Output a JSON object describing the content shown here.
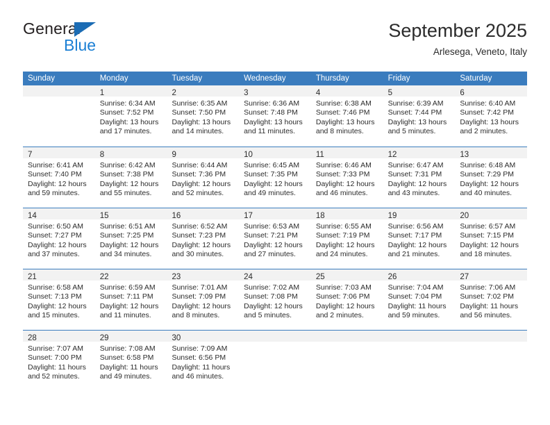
{
  "brand": {
    "name_part1": "General",
    "name_part2": "Blue",
    "accent_color": "#1b7fd4",
    "triangle_color": "#1b6cb4"
  },
  "header": {
    "title": "September 2025",
    "subtitle": "Arlesega, Veneto, Italy"
  },
  "calendar": {
    "header_bg": "#3a7cbe",
    "date_strip_bg": "#f2f2f2",
    "weekdays": [
      "Sunday",
      "Monday",
      "Tuesday",
      "Wednesday",
      "Thursday",
      "Friday",
      "Saturday"
    ],
    "weeks": [
      [
        {
          "date": "",
          "sunrise": "",
          "sunset": "",
          "daylight1": "",
          "daylight2": ""
        },
        {
          "date": "1",
          "sunrise": "Sunrise: 6:34 AM",
          "sunset": "Sunset: 7:52 PM",
          "daylight1": "Daylight: 13 hours",
          "daylight2": "and 17 minutes."
        },
        {
          "date": "2",
          "sunrise": "Sunrise: 6:35 AM",
          "sunset": "Sunset: 7:50 PM",
          "daylight1": "Daylight: 13 hours",
          "daylight2": "and 14 minutes."
        },
        {
          "date": "3",
          "sunrise": "Sunrise: 6:36 AM",
          "sunset": "Sunset: 7:48 PM",
          "daylight1": "Daylight: 13 hours",
          "daylight2": "and 11 minutes."
        },
        {
          "date": "4",
          "sunrise": "Sunrise: 6:38 AM",
          "sunset": "Sunset: 7:46 PM",
          "daylight1": "Daylight: 13 hours",
          "daylight2": "and 8 minutes."
        },
        {
          "date": "5",
          "sunrise": "Sunrise: 6:39 AM",
          "sunset": "Sunset: 7:44 PM",
          "daylight1": "Daylight: 13 hours",
          "daylight2": "and 5 minutes."
        },
        {
          "date": "6",
          "sunrise": "Sunrise: 6:40 AM",
          "sunset": "Sunset: 7:42 PM",
          "daylight1": "Daylight: 13 hours",
          "daylight2": "and 2 minutes."
        }
      ],
      [
        {
          "date": "7",
          "sunrise": "Sunrise: 6:41 AM",
          "sunset": "Sunset: 7:40 PM",
          "daylight1": "Daylight: 12 hours",
          "daylight2": "and 59 minutes."
        },
        {
          "date": "8",
          "sunrise": "Sunrise: 6:42 AM",
          "sunset": "Sunset: 7:38 PM",
          "daylight1": "Daylight: 12 hours",
          "daylight2": "and 55 minutes."
        },
        {
          "date": "9",
          "sunrise": "Sunrise: 6:44 AM",
          "sunset": "Sunset: 7:36 PM",
          "daylight1": "Daylight: 12 hours",
          "daylight2": "and 52 minutes."
        },
        {
          "date": "10",
          "sunrise": "Sunrise: 6:45 AM",
          "sunset": "Sunset: 7:35 PM",
          "daylight1": "Daylight: 12 hours",
          "daylight2": "and 49 minutes."
        },
        {
          "date": "11",
          "sunrise": "Sunrise: 6:46 AM",
          "sunset": "Sunset: 7:33 PM",
          "daylight1": "Daylight: 12 hours",
          "daylight2": "and 46 minutes."
        },
        {
          "date": "12",
          "sunrise": "Sunrise: 6:47 AM",
          "sunset": "Sunset: 7:31 PM",
          "daylight1": "Daylight: 12 hours",
          "daylight2": "and 43 minutes."
        },
        {
          "date": "13",
          "sunrise": "Sunrise: 6:48 AM",
          "sunset": "Sunset: 7:29 PM",
          "daylight1": "Daylight: 12 hours",
          "daylight2": "and 40 minutes."
        }
      ],
      [
        {
          "date": "14",
          "sunrise": "Sunrise: 6:50 AM",
          "sunset": "Sunset: 7:27 PM",
          "daylight1": "Daylight: 12 hours",
          "daylight2": "and 37 minutes."
        },
        {
          "date": "15",
          "sunrise": "Sunrise: 6:51 AM",
          "sunset": "Sunset: 7:25 PM",
          "daylight1": "Daylight: 12 hours",
          "daylight2": "and 34 minutes."
        },
        {
          "date": "16",
          "sunrise": "Sunrise: 6:52 AM",
          "sunset": "Sunset: 7:23 PM",
          "daylight1": "Daylight: 12 hours",
          "daylight2": "and 30 minutes."
        },
        {
          "date": "17",
          "sunrise": "Sunrise: 6:53 AM",
          "sunset": "Sunset: 7:21 PM",
          "daylight1": "Daylight: 12 hours",
          "daylight2": "and 27 minutes."
        },
        {
          "date": "18",
          "sunrise": "Sunrise: 6:55 AM",
          "sunset": "Sunset: 7:19 PM",
          "daylight1": "Daylight: 12 hours",
          "daylight2": "and 24 minutes."
        },
        {
          "date": "19",
          "sunrise": "Sunrise: 6:56 AM",
          "sunset": "Sunset: 7:17 PM",
          "daylight1": "Daylight: 12 hours",
          "daylight2": "and 21 minutes."
        },
        {
          "date": "20",
          "sunrise": "Sunrise: 6:57 AM",
          "sunset": "Sunset: 7:15 PM",
          "daylight1": "Daylight: 12 hours",
          "daylight2": "and 18 minutes."
        }
      ],
      [
        {
          "date": "21",
          "sunrise": "Sunrise: 6:58 AM",
          "sunset": "Sunset: 7:13 PM",
          "daylight1": "Daylight: 12 hours",
          "daylight2": "and 15 minutes."
        },
        {
          "date": "22",
          "sunrise": "Sunrise: 6:59 AM",
          "sunset": "Sunset: 7:11 PM",
          "daylight1": "Daylight: 12 hours",
          "daylight2": "and 11 minutes."
        },
        {
          "date": "23",
          "sunrise": "Sunrise: 7:01 AM",
          "sunset": "Sunset: 7:09 PM",
          "daylight1": "Daylight: 12 hours",
          "daylight2": "and 8 minutes."
        },
        {
          "date": "24",
          "sunrise": "Sunrise: 7:02 AM",
          "sunset": "Sunset: 7:08 PM",
          "daylight1": "Daylight: 12 hours",
          "daylight2": "and 5 minutes."
        },
        {
          "date": "25",
          "sunrise": "Sunrise: 7:03 AM",
          "sunset": "Sunset: 7:06 PM",
          "daylight1": "Daylight: 12 hours",
          "daylight2": "and 2 minutes."
        },
        {
          "date": "26",
          "sunrise": "Sunrise: 7:04 AM",
          "sunset": "Sunset: 7:04 PM",
          "daylight1": "Daylight: 11 hours",
          "daylight2": "and 59 minutes."
        },
        {
          "date": "27",
          "sunrise": "Sunrise: 7:06 AM",
          "sunset": "Sunset: 7:02 PM",
          "daylight1": "Daylight: 11 hours",
          "daylight2": "and 56 minutes."
        }
      ],
      [
        {
          "date": "28",
          "sunrise": "Sunrise: 7:07 AM",
          "sunset": "Sunset: 7:00 PM",
          "daylight1": "Daylight: 11 hours",
          "daylight2": "and 52 minutes."
        },
        {
          "date": "29",
          "sunrise": "Sunrise: 7:08 AM",
          "sunset": "Sunset: 6:58 PM",
          "daylight1": "Daylight: 11 hours",
          "daylight2": "and 49 minutes."
        },
        {
          "date": "30",
          "sunrise": "Sunrise: 7:09 AM",
          "sunset": "Sunset: 6:56 PM",
          "daylight1": "Daylight: 11 hours",
          "daylight2": "and 46 minutes."
        },
        {
          "date": "",
          "sunrise": "",
          "sunset": "",
          "daylight1": "",
          "daylight2": ""
        },
        {
          "date": "",
          "sunrise": "",
          "sunset": "",
          "daylight1": "",
          "daylight2": ""
        },
        {
          "date": "",
          "sunrise": "",
          "sunset": "",
          "daylight1": "",
          "daylight2": ""
        },
        {
          "date": "",
          "sunrise": "",
          "sunset": "",
          "daylight1": "",
          "daylight2": ""
        }
      ]
    ]
  }
}
